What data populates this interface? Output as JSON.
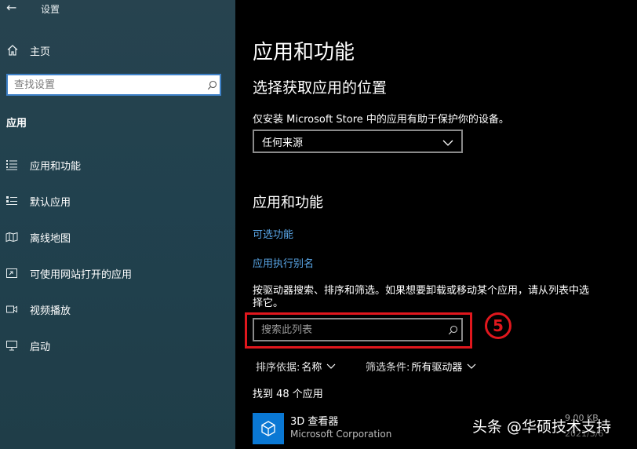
{
  "window": {
    "title": "设置"
  },
  "sidebar": {
    "home_label": "主页",
    "search_placeholder": "查找设置",
    "section_heading": "应用",
    "items": [
      {
        "label": "应用和功能",
        "icon": "apps-features-icon"
      },
      {
        "label": "默认应用",
        "icon": "default-apps-icon"
      },
      {
        "label": "离线地图",
        "icon": "offline-maps-icon"
      },
      {
        "label": "可使用网站打开的应用",
        "icon": "apps-for-websites-icon"
      },
      {
        "label": "视频播放",
        "icon": "video-playback-icon"
      },
      {
        "label": "启动",
        "icon": "startup-icon"
      }
    ]
  },
  "main": {
    "page_title": "应用和功能",
    "install_section": {
      "title": "选择获取应用的位置",
      "description": "仅安装 Microsoft Store 中的应用有助于保护你的设备。",
      "dropdown_value": "任何来源"
    },
    "apps_section": {
      "title": "应用和功能",
      "links": [
        "可选功能",
        "应用执行别名"
      ],
      "description": "按驱动器搜索、排序和筛选。如果想要卸载或移动某个应用，请从列表中选择它。",
      "search_placeholder": "搜索此列表",
      "sort_label": "排序依据:",
      "sort_value": "名称",
      "filter_label": "筛选条件:",
      "filter_value": "所有驱动器",
      "found_text": "找到 48 个应用",
      "apps": [
        {
          "name": "3D 查看器",
          "publisher": "Microsoft Corporation",
          "size": "9.00 KB",
          "date": "2021/3/6"
        }
      ]
    }
  },
  "annotation": {
    "step_number": "5"
  },
  "watermark": {
    "text": "头条 @华硕技术支持"
  },
  "colors": {
    "sidebar_bg": "#21414e",
    "accent_link": "#5aa7e8",
    "highlight_red": "#e0171d",
    "app_icon_bg": "#0a78d4"
  }
}
